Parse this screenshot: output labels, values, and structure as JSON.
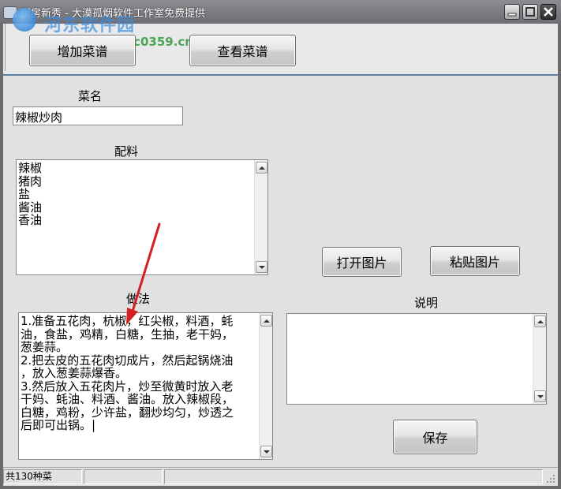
{
  "window": {
    "title": "厨房新秀 - 大漠孤烟软件工作室免费提供",
    "watermark_name": "河东软件园",
    "watermark_url": "www.pc0359.cn"
  },
  "toolbar": {
    "add_recipe_label": "增加菜谱",
    "view_recipe_label": "查看菜谱"
  },
  "form": {
    "dish_name_label": "菜名",
    "dish_name_value": "辣椒炒肉",
    "ingredients_label": "配料",
    "ingredients_value": "辣椒\n猪肉\n盐\n酱油\n香油",
    "method_label": "做法",
    "method_value": "1.准备五花肉，杭椒，红尖椒，料酒，蚝\n油，食盐，鸡精，白糖，生抽，老干妈，\n葱姜蒜。\n2.把去皮的五花肉切成片，然后起锅烧油\n，放入葱姜蒜爆香。\n3.然后放入五花肉片，炒至微黄时放入老\n干妈、蚝油、料酒、酱油。放入辣椒段，\n白糖，鸡粉，少许盐，翻炒均匀，炒透之\n后即可出锅。|",
    "notes_label": "说明",
    "notes_value": ""
  },
  "buttons": {
    "open_image": "打开图片",
    "paste_image": "粘贴图片",
    "save": "保存"
  },
  "status": {
    "recipe_count": "共130种菜"
  },
  "colors": {
    "annotation_arrow": "#d42020",
    "accent_line": "#5b7fa0"
  }
}
